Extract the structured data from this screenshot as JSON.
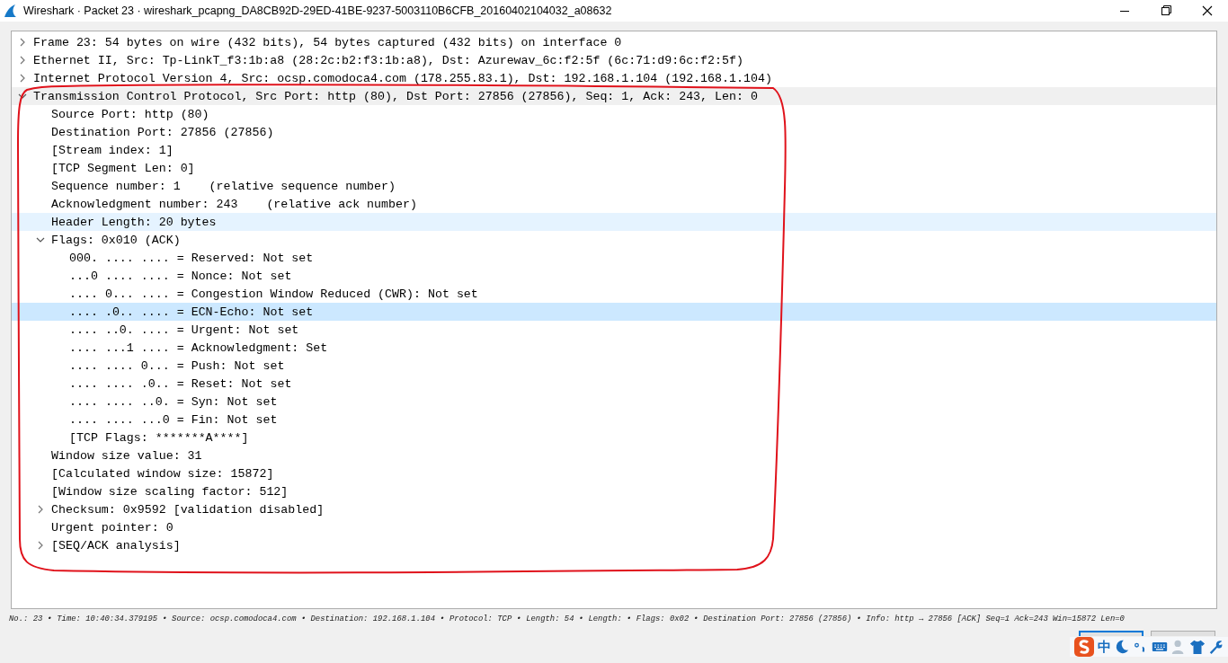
{
  "window": {
    "title": "Wireshark · Packet 23 · wireshark_pcapng_DA8CB92D-29ED-41BE-9237-5003110B6CFB_20160402104032_a08632"
  },
  "tree": [
    {
      "text": "Frame 23: 54 bytes on wire (432 bits), 54 bytes captured (432 bits) on interface 0",
      "expanded": false,
      "selected": false,
      "hovered": false
    },
    {
      "text": "Ethernet II, Src: Tp-LinkT_f3:1b:a8 (28:2c:b2:f3:1b:a8), Dst: Azurewav_6c:f2:5f (6c:71:d9:6c:f2:5f)",
      "expanded": false,
      "selected": false,
      "hovered": false
    },
    {
      "text": "Internet Protocol Version 4, Src: ocsp.comodoca4.com (178.255.83.1), Dst: 192.168.1.104 (192.168.1.104)",
      "expanded": false,
      "selected": false,
      "hovered": false
    },
    {
      "text": "Transmission Control Protocol, Src Port: http (80), Dst Port: 27856 (27856), Seq: 1, Ack: 243, Len: 0",
      "expanded": true,
      "selected": false,
      "hovered": false,
      "children": [
        {
          "text": "Source Port: http (80)",
          "selected": false,
          "hovered": false
        },
        {
          "text": "Destination Port: 27856 (27856)",
          "selected": false,
          "hovered": false
        },
        {
          "text": "[Stream index: 1]",
          "selected": false,
          "hovered": false
        },
        {
          "text": "[TCP Segment Len: 0]",
          "selected": false,
          "hovered": false
        },
        {
          "text": "Sequence number: 1    (relative sequence number)",
          "selected": false,
          "hovered": false
        },
        {
          "text": "Acknowledgment number: 243    (relative ack number)",
          "selected": false,
          "hovered": false
        },
        {
          "text": "Header Length: 20 bytes",
          "selected": false,
          "hovered": true
        },
        {
          "text": "Flags: 0x010 (ACK)",
          "expanded": true,
          "selected": false,
          "hovered": false,
          "children": [
            {
              "text": "000. .... .... = Reserved: Not set",
              "selected": false,
              "hovered": false
            },
            {
              "text": "...0 .... .... = Nonce: Not set",
              "selected": false,
              "hovered": false
            },
            {
              "text": ".... 0... .... = Congestion Window Reduced (CWR): Not set",
              "selected": false,
              "hovered": false
            },
            {
              "text": ".... .0.. .... = ECN-Echo: Not set",
              "selected": true,
              "hovered": false
            },
            {
              "text": ".... ..0. .... = Urgent: Not set",
              "selected": false,
              "hovered": false
            },
            {
              "text": ".... ...1 .... = Acknowledgment: Set",
              "selected": false,
              "hovered": false
            },
            {
              "text": ".... .... 0... = Push: Not set",
              "selected": false,
              "hovered": false
            },
            {
              "text": ".... .... .0.. = Reset: Not set",
              "selected": false,
              "hovered": false
            },
            {
              "text": ".... .... ..0. = Syn: Not set",
              "selected": false,
              "hovered": false
            },
            {
              "text": ".... .... ...0 = Fin: Not set",
              "selected": false,
              "hovered": false
            },
            {
              "text": "[TCP Flags: *******A****]",
              "selected": false,
              "hovered": false
            }
          ]
        },
        {
          "text": "Window size value: 31",
          "selected": false,
          "hovered": false
        },
        {
          "text": "[Calculated window size: 15872]",
          "selected": false,
          "hovered": false
        },
        {
          "text": "[Window size scaling factor: 512]",
          "selected": false,
          "hovered": false
        },
        {
          "text": "Checksum: 0x9592 [validation disabled]",
          "expanded": false,
          "selected": false,
          "hovered": false
        },
        {
          "text": "Urgent pointer: 0",
          "selected": false,
          "hovered": false
        },
        {
          "text": "[SEQ/ACK analysis]",
          "expanded": false,
          "selected": false,
          "hovered": false
        }
      ]
    }
  ],
  "status_line": "No.: 23 • Time: 10:40:34.379195 • Source: ocsp.comodoca4.com • Destination: 192.168.1.104 • Protocol: TCP • Length: 54 • Length: • Flags: 0x02 • Destination Port: 27856 (27856) • Info: http → 27856 [ACK] Seq=1 Ack=243 Win=15872 Len=0",
  "ime_toolbar": {
    "mode": "中"
  }
}
